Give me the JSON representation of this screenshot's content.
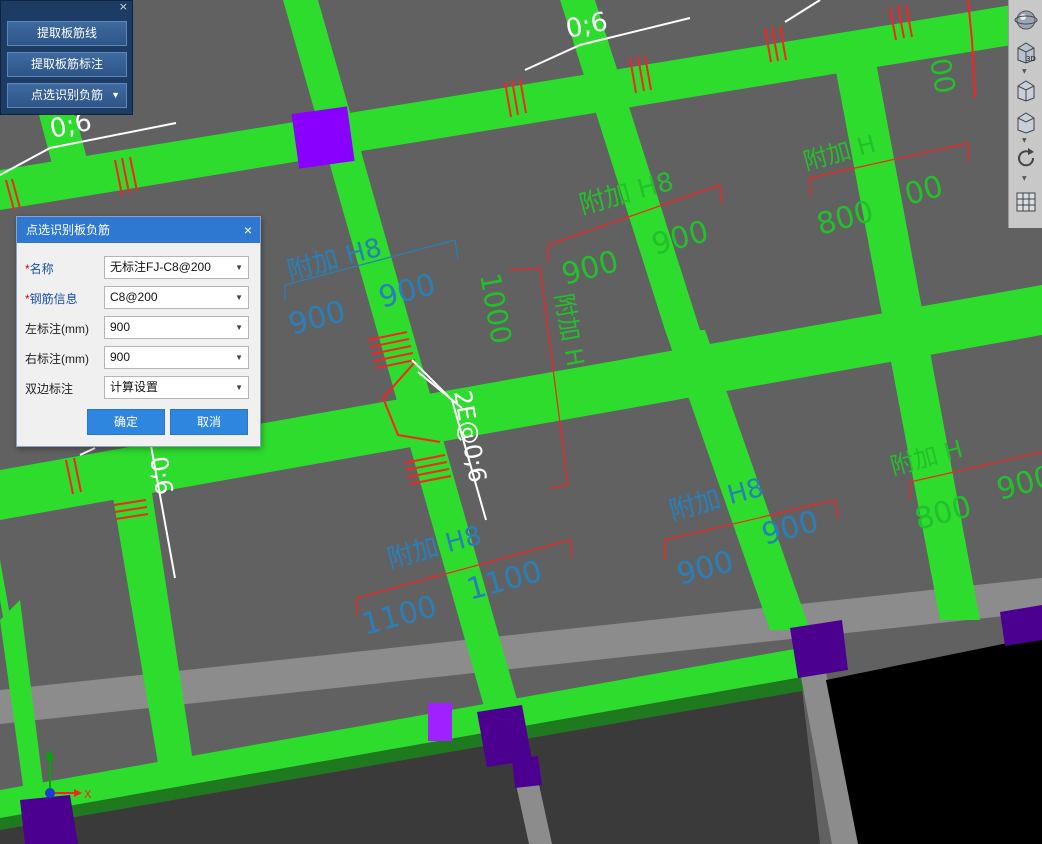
{
  "tool_panel": {
    "close_glyph": "×",
    "buttons": [
      {
        "label": "提取板筋线"
      },
      {
        "label": "提取板筋标注"
      },
      {
        "label": "点选识别负筋"
      }
    ]
  },
  "dialog": {
    "title": "点选识别板负筋",
    "close_glyph": "×",
    "fields": [
      {
        "label": "名称",
        "required": true,
        "value": "无标注FJ-C8@200"
      },
      {
        "label": "钢筋信息",
        "required": true,
        "value": "C8@200"
      },
      {
        "label": "左标注(mm)",
        "required": false,
        "value": "900"
      },
      {
        "label": "右标注(mm)",
        "required": false,
        "value": "900"
      },
      {
        "label": "双边标注",
        "required": false,
        "value": "计算设置"
      }
    ],
    "required_mark": "*",
    "ok_label": "确定",
    "cancel_label": "取消"
  },
  "cad_labels": {
    "spacing_a": "0;6",
    "spacing_b": "0;6",
    "spacing_c": "0;6",
    "spacing_d": "0;6",
    "fj_1": "附加 H8",
    "fj_2": "附加 H8",
    "fj_3": "附加 H8",
    "fj_4": "附加 H8",
    "fj_5": "附加 H",
    "fj_6": "附加 H",
    "fj_7": "附加 H",
    "dim_900_a": "900",
    "dim_900_b": "900",
    "dim_900_c": "900",
    "dim_900_d": "900",
    "dim_900_e": "900",
    "dim_900_f": "900",
    "dim_900_g": "900",
    "dim_800_a": "800",
    "dim_800_b": "800",
    "dim_1000": "1000",
    "dim_1100_a": "1100",
    "dim_1100_b": "1100",
    "dim_00": "00",
    "dim_00b": "00",
    "overlap_text": "2E@0;6",
    "axis_x": "X",
    "axis_y": "Y"
  },
  "view_toolbar": {
    "icons": [
      "orbit-icon",
      "view-3d-icon",
      "view-box-icon",
      "rotate-icon",
      "layer-grid-icon"
    ],
    "label_3d": "3D"
  },
  "colors": {
    "background": "#616161",
    "beam": "#2ddc2d",
    "column": "#8a00ff",
    "column_dark": "#4b0090",
    "rebar": "#ff2020",
    "annotation_green": "#22c02a",
    "annotation_blue": "#2a7fb8",
    "dialog_title": "#2f78d2"
  }
}
